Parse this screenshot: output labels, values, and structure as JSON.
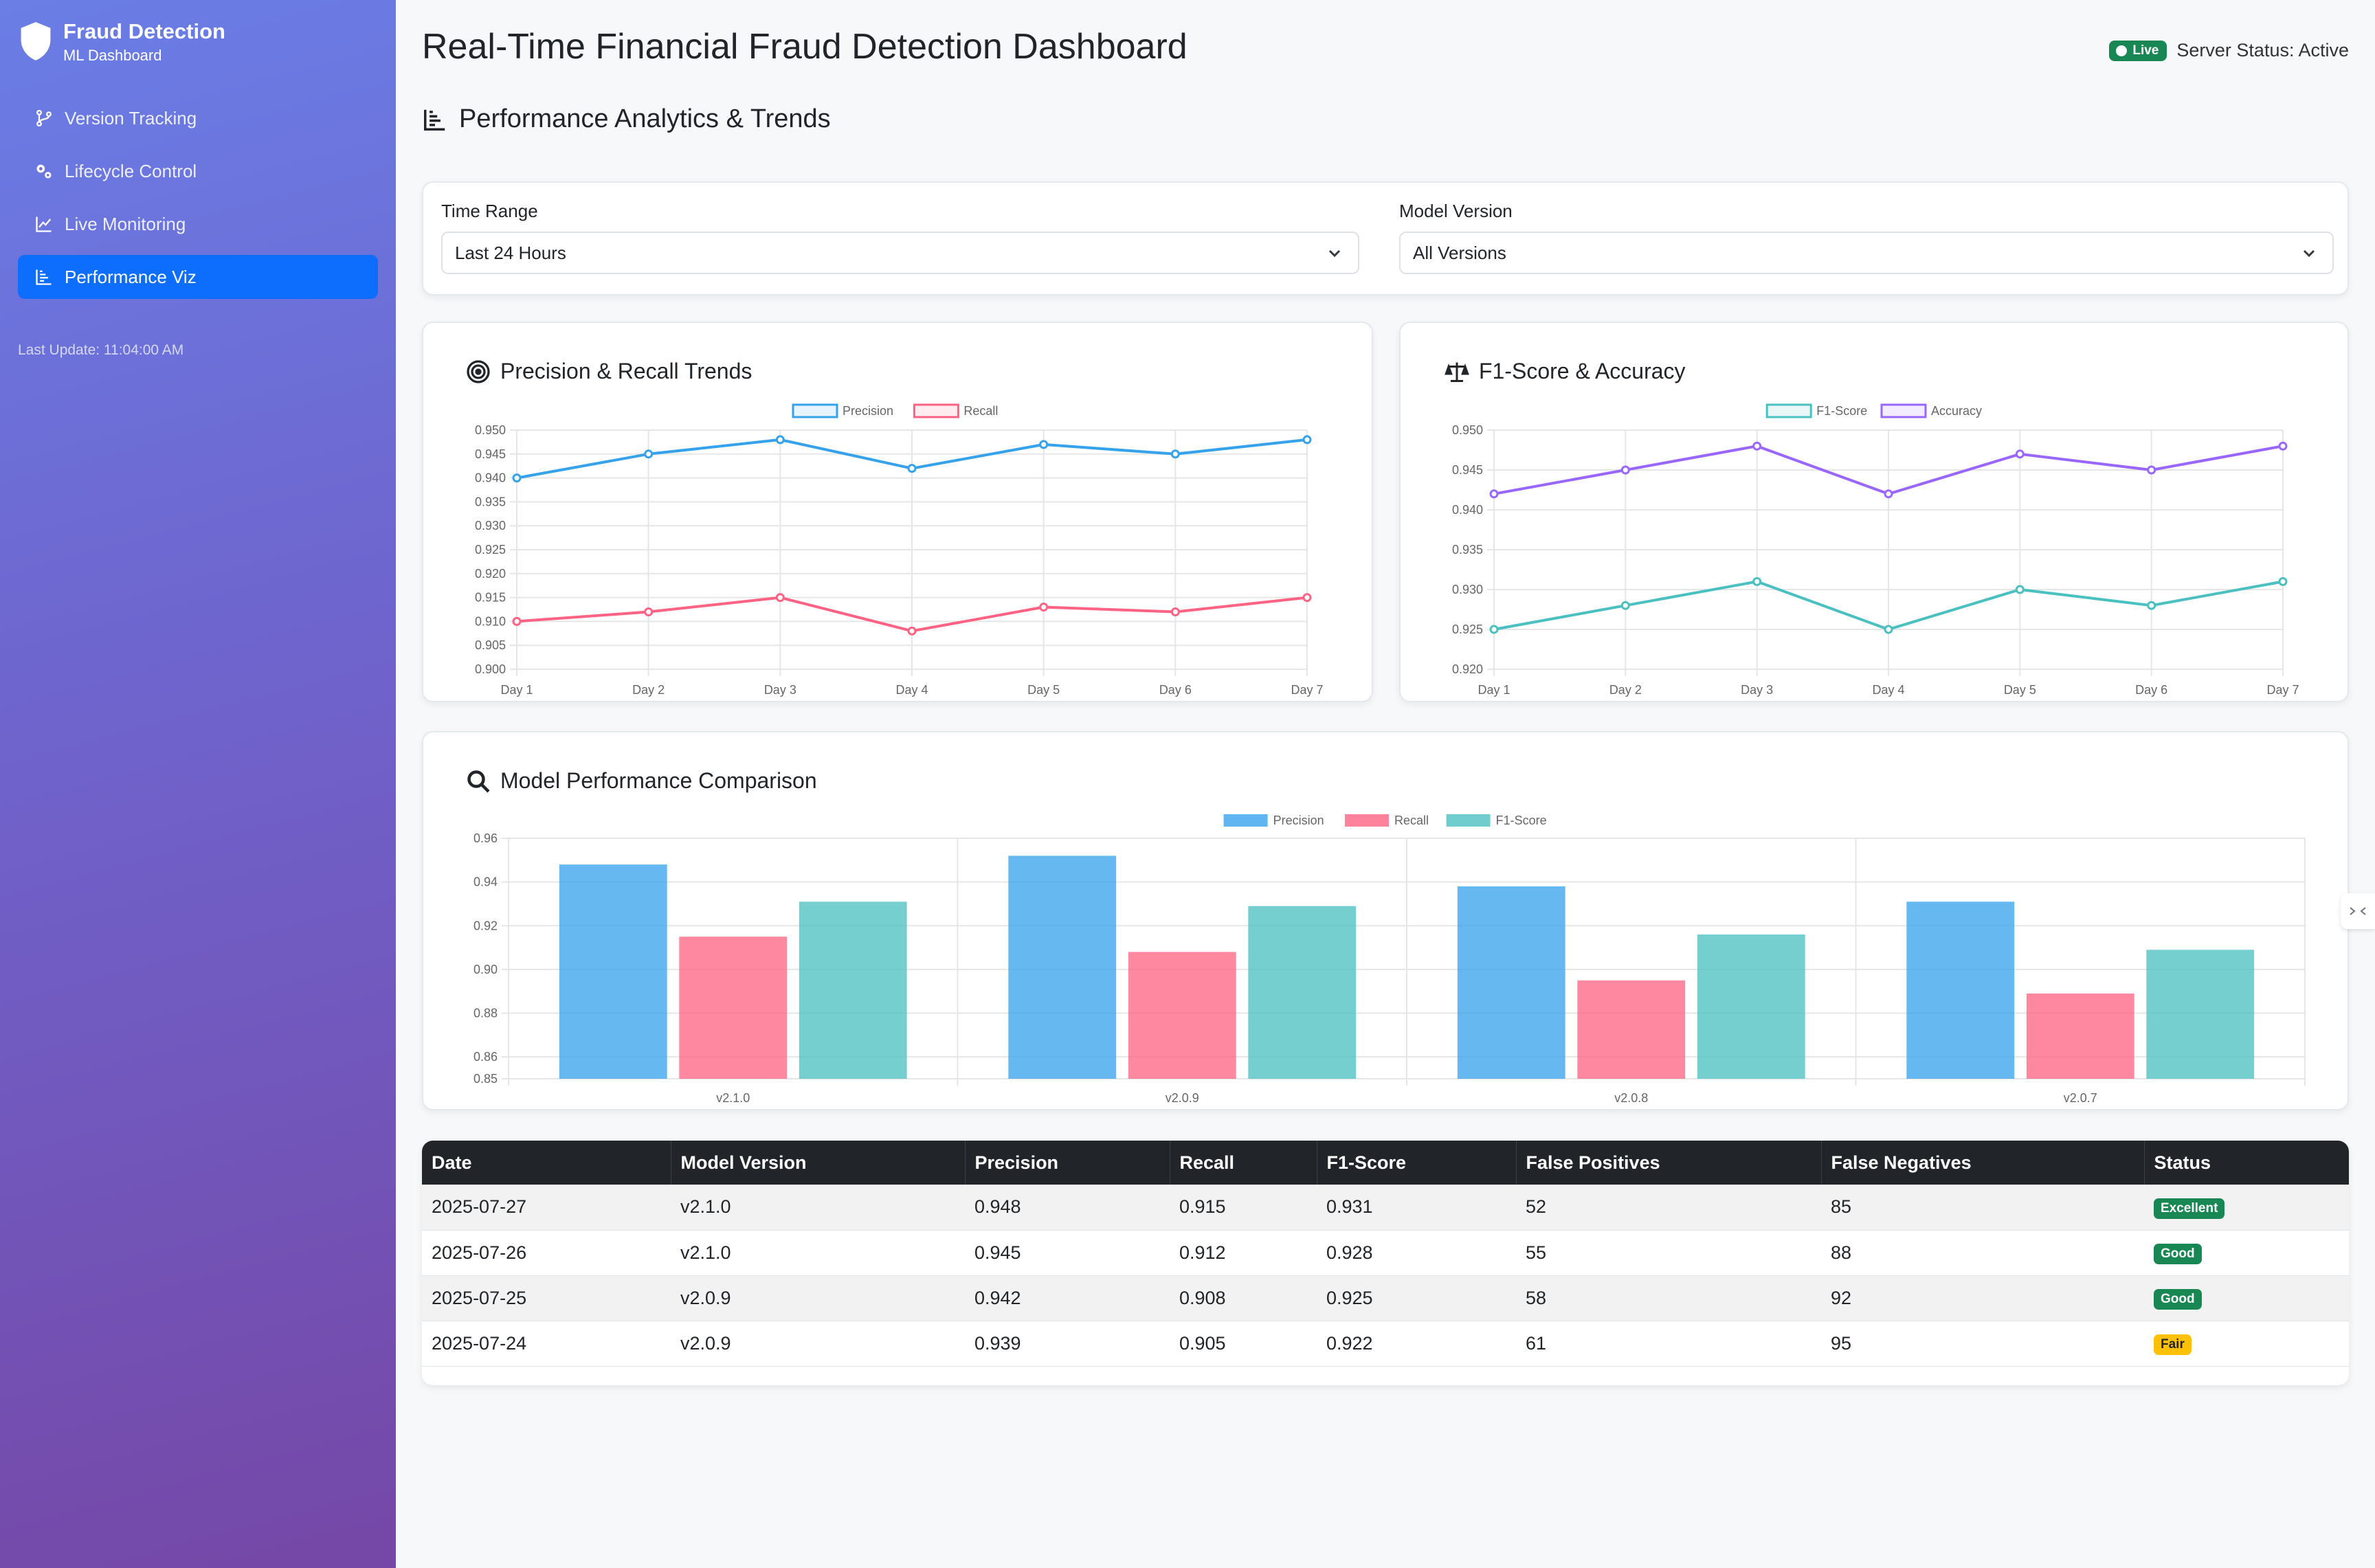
{
  "sidebar": {
    "brand_title": "Fraud Detection",
    "brand_subtitle": "ML Dashboard",
    "items": [
      {
        "label": "Version Tracking",
        "icon": "branch-icon",
        "active": false
      },
      {
        "label": "Lifecycle Control",
        "icon": "gears-icon",
        "active": false
      },
      {
        "label": "Live Monitoring",
        "icon": "line-chart-icon",
        "active": false
      },
      {
        "label": "Performance Viz",
        "icon": "bar-chart-icon",
        "active": true
      }
    ],
    "last_update": "Last Update: 11:04:00 AM"
  },
  "header": {
    "title": "Real-Time Financial Fraud Detection Dashboard",
    "live_label": "Live",
    "server_status": "Server Status: Active"
  },
  "section": {
    "title": "Performance Analytics & Trends"
  },
  "filters": {
    "time_range": {
      "label": "Time Range",
      "value": "Last 24 Hours"
    },
    "model_version": {
      "label": "Model Version",
      "value": "All Versions"
    }
  },
  "colors": {
    "precision": "#36a2eb",
    "recall": "#ff6384",
    "f1": "#4bc0c0",
    "accuracy": "#9966ff",
    "active_nav": "#0d6efd",
    "success": "#198754",
    "warning": "#ffc107"
  },
  "chart_data": [
    {
      "id": "precision-recall",
      "title": "Precision & Recall Trends",
      "type": "line",
      "x": [
        "Day 1",
        "Day 2",
        "Day 3",
        "Day 4",
        "Day 5",
        "Day 6",
        "Day 7"
      ],
      "series": [
        {
          "name": "Precision",
          "values": [
            0.94,
            0.945,
            0.948,
            0.942,
            0.947,
            0.945,
            0.948
          ]
        },
        {
          "name": "Recall",
          "values": [
            0.91,
            0.912,
            0.915,
            0.908,
            0.913,
            0.912,
            0.915
          ]
        }
      ],
      "ylim": [
        0.9,
        0.95
      ],
      "yticks": [
        "0.950",
        "0.945",
        "0.940",
        "0.935",
        "0.930",
        "0.925",
        "0.920",
        "0.915",
        "0.910",
        "0.905",
        "0.900"
      ],
      "legend": "top",
      "grid": true
    },
    {
      "id": "f1-accuracy",
      "title": "F1-Score & Accuracy",
      "type": "line",
      "x": [
        "Day 1",
        "Day 2",
        "Day 3",
        "Day 4",
        "Day 5",
        "Day 6",
        "Day 7"
      ],
      "series": [
        {
          "name": "F1-Score",
          "values": [
            0.925,
            0.928,
            0.931,
            0.925,
            0.93,
            0.928,
            0.931
          ]
        },
        {
          "name": "Accuracy",
          "values": [
            0.942,
            0.945,
            0.948,
            0.942,
            0.947,
            0.945,
            0.948
          ]
        }
      ],
      "ylim": [
        0.92,
        0.95
      ],
      "yticks": [
        "0.950",
        "0.945",
        "0.940",
        "0.935",
        "0.930",
        "0.925",
        "0.920"
      ],
      "legend": "top",
      "grid": true
    },
    {
      "id": "model-comparison",
      "title": "Model Performance Comparison",
      "type": "bar",
      "categories": [
        "v2.1.0",
        "v2.0.9",
        "v2.0.8",
        "v2.0.7"
      ],
      "series": [
        {
          "name": "Precision",
          "values": [
            0.948,
            0.952,
            0.938,
            0.931
          ]
        },
        {
          "name": "Recall",
          "values": [
            0.915,
            0.908,
            0.895,
            0.889
          ]
        },
        {
          "name": "F1-Score",
          "values": [
            0.931,
            0.929,
            0.916,
            0.909
          ]
        }
      ],
      "ylim": [
        0.85,
        0.96
      ],
      "yticks": [
        "0.96",
        "0.94",
        "0.92",
        "0.90",
        "0.88",
        "0.86",
        "0.85"
      ],
      "legend": "top",
      "grid": true
    }
  ],
  "table": {
    "headers": [
      "Date",
      "Model Version",
      "Precision",
      "Recall",
      "F1-Score",
      "False Positives",
      "False Negatives",
      "Status"
    ],
    "rows": [
      {
        "date": "2025-07-27",
        "version": "v2.1.0",
        "precision": "0.948",
        "recall": "0.915",
        "f1": "0.931",
        "fp": "52",
        "fn": "85",
        "status": "Excellent",
        "status_type": "success"
      },
      {
        "date": "2025-07-26",
        "version": "v2.1.0",
        "precision": "0.945",
        "recall": "0.912",
        "f1": "0.928",
        "fp": "55",
        "fn": "88",
        "status": "Good",
        "status_type": "success"
      },
      {
        "date": "2025-07-25",
        "version": "v2.0.9",
        "precision": "0.942",
        "recall": "0.908",
        "f1": "0.925",
        "fp": "58",
        "fn": "92",
        "status": "Good",
        "status_type": "success"
      },
      {
        "date": "2025-07-24",
        "version": "v2.0.9",
        "precision": "0.939",
        "recall": "0.905",
        "f1": "0.922",
        "fp": "61",
        "fn": "95",
        "status": "Fair",
        "status_type": "warning"
      }
    ]
  }
}
